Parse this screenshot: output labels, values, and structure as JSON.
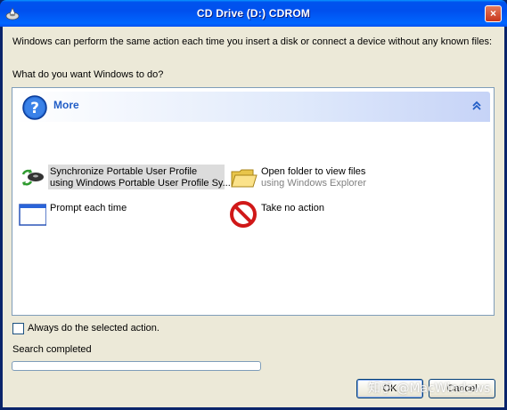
{
  "window": {
    "title": "CD Drive (D:) CDROM",
    "close_glyph": "×"
  },
  "dialog": {
    "intro": "Windows can perform the same action each time you insert a disk or connect a device without any known files:",
    "question": "What do you want Windows to do?"
  },
  "section": {
    "title": "More",
    "icon": "question-icon",
    "toggle_icon": "collapse-up-icon"
  },
  "actions": [
    {
      "line1": "Synchronize Portable User Profile",
      "line2": "using Windows Portable User Profile Sy...",
      "icon": "sync-profile-icon",
      "selected": true
    },
    {
      "line1": "Open folder to view files",
      "line2": "using Windows Explorer",
      "icon": "folder-icon",
      "selected": false
    },
    {
      "line1": "Prompt each time",
      "line2": "",
      "icon": "window-icon",
      "selected": false
    },
    {
      "line1": "Take no action",
      "line2": "",
      "icon": "no-action-icon",
      "selected": false
    }
  ],
  "options": {
    "always_label": "Always do the selected action.",
    "always_checked": false
  },
  "status": {
    "text": "Search completed",
    "progress": 0
  },
  "buttons": {
    "ok": "OK",
    "cancel": "Cancel"
  },
  "watermark": "知乎 @MacWindows",
  "colors": {
    "title_bar": "#0054e3",
    "section_title": "#215dc6",
    "dialog_bg": "#ece9d8"
  }
}
